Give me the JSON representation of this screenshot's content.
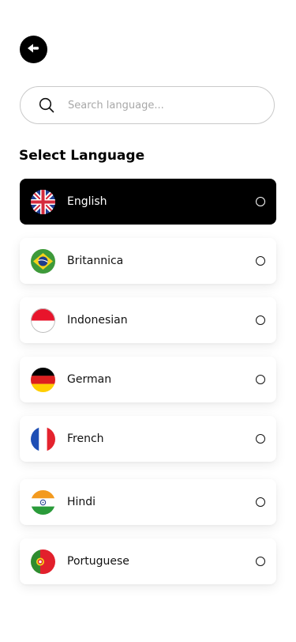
{
  "header": {
    "back_icon": "back-arrow-icon"
  },
  "search": {
    "placeholder": "Search language...",
    "value": "",
    "icon": "search-icon"
  },
  "section_title": "Select Language",
  "languages": [
    {
      "label": "English",
      "flag": "uk-flag-icon",
      "selected": true
    },
    {
      "label": "Britannica",
      "flag": "brazil-flag-icon",
      "selected": false
    },
    {
      "label": "Indonesian",
      "flag": "indonesia-flag-icon",
      "selected": false
    },
    {
      "label": "German",
      "flag": "germany-flag-icon",
      "selected": false
    },
    {
      "label": "French",
      "flag": "france-flag-icon",
      "selected": false
    },
    {
      "label": "Hindi",
      "flag": "india-flag-icon",
      "selected": false
    },
    {
      "label": "Portuguese",
      "flag": "portugal-flag-icon",
      "selected": false
    }
  ],
  "colors": {
    "selected_bg": "#000000",
    "card_bg": "#ffffff",
    "text": "#111111"
  }
}
